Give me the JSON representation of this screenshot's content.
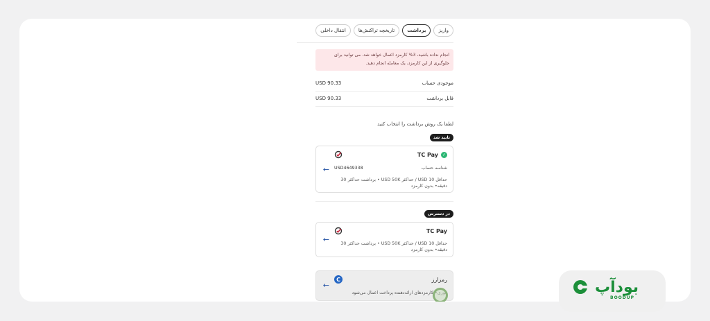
{
  "tabs": [
    {
      "label": "واریز",
      "active": false
    },
    {
      "label": "برداشت",
      "active": true
    },
    {
      "label": "تاریخچه تراکنش‌ها",
      "active": false
    },
    {
      "label": "انتقال داخلی",
      "active": false
    }
  ],
  "alert": {
    "line1": "انجام نداده باشید، 3% کارمزد اعمال خواهد شد. می توانید برای",
    "line2": "جلوگیری از این کارمزد، یک معامله انجام دهید."
  },
  "balance": {
    "label": "موجودی حساب",
    "value": "USD 90.33"
  },
  "withdrawable": {
    "label": "قابل برداشت",
    "value": "USD 90.33"
  },
  "prompt": "لطفا یک روش برداشت را انتخاب کنید",
  "verified_badge": "تایید شد",
  "available_badge": "در دسترس",
  "method_verified": {
    "title": "TC Pay",
    "account_label": "شناسه حساب",
    "account_value": "USD4649338",
    "limits_line1": "حداقل USD 10 / حداکثر USD 50K  •  برداشت حداکثر 30",
    "limits_line2": "دقیقه• بدون کارمزد"
  },
  "method_available": {
    "title": "TC Pay",
    "limits_line1": "حداقل USD 10 / حداکثر USD 50K  •  برداشت حداکثر 30",
    "limits_line2": "دقیقه• بدون کارمزد"
  },
  "method_crypto": {
    "title": "رمزارز",
    "desc": "فوری• کارمزدهای ارائه‌دهنده پرداخت اعمال می‌شود"
  },
  "brand": {
    "name": "بودآپ",
    "sub": "BOODUP"
  },
  "colors": {
    "accent_green": "#1c8f3a",
    "alert_bg": "#fde7e9",
    "arrow_blue": "#1f4fa3"
  }
}
